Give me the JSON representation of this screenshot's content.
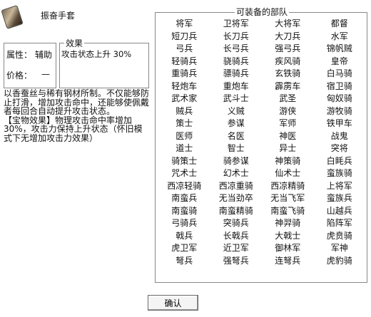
{
  "item": {
    "name": "振奋手套"
  },
  "effect": {
    "legend": "效果",
    "text": "攻击状态上升 30%"
  },
  "attributes": [
    {
      "label": "属性：",
      "value": "辅助"
    },
    {
      "label": "价格：",
      "value": "—"
    }
  ],
  "description": "以香蚕丝与稀有钢材所制。不仅能够防止打滑，增加攻击命中，还能够使佩戴者每回合自动提升攻击状态。\n【宝物效果】物理攻击命中率增加30%，攻击力保持上升状态（怀旧模式下无增加攻击力效果）",
  "units": {
    "legend": "可装备的部队",
    "items": [
      "将军",
      "卫将军",
      "大将军",
      "都督",
      "短刀兵",
      "长刀兵",
      "大刀兵",
      "水军",
      "弓兵",
      "长弓兵",
      "强弓兵",
      "锦帆贼",
      "轻骑兵",
      "骁骑兵",
      "疾风骑",
      "皇帝",
      "重骑兵",
      "骠骑兵",
      "玄铁骑",
      "白马骑",
      "轻炮车",
      "重炮车",
      "霹雳车",
      "宿卫骑",
      "武术家",
      "武斗士",
      "武圣",
      "匈奴骑",
      "贼兵",
      "义贼",
      "游侠",
      "游牧骑",
      "策士",
      "参谋",
      "军师",
      "铁甲车",
      "医师",
      "名医",
      "神医",
      "战鬼",
      "道士",
      "智士",
      "异士",
      "突将",
      "骑策士",
      "骑参谋",
      "神策骑",
      "白眊兵",
      "咒术士",
      "幻术士",
      "仙术士",
      "蛮族骑",
      "西凉轻骑",
      "西凉重骑",
      "西凉精骑",
      "上将军",
      "南蛮兵",
      "无当劲卒",
      "无当飞军",
      "蛮族兵",
      "南蛮骑",
      "南蛮精骑",
      "南蛮飞骑",
      "山越兵",
      "弓骑兵",
      "突骑兵",
      "神羿骑",
      "陷阵军",
      "戟兵",
      "长戟兵",
      "大戟士",
      "虎贲骑",
      "虎卫军",
      "近卫军",
      "御林军",
      "军神",
      "弩兵",
      "强弩兵",
      "连弩兵",
      "虎豹骑"
    ]
  },
  "confirm_label": "确认"
}
